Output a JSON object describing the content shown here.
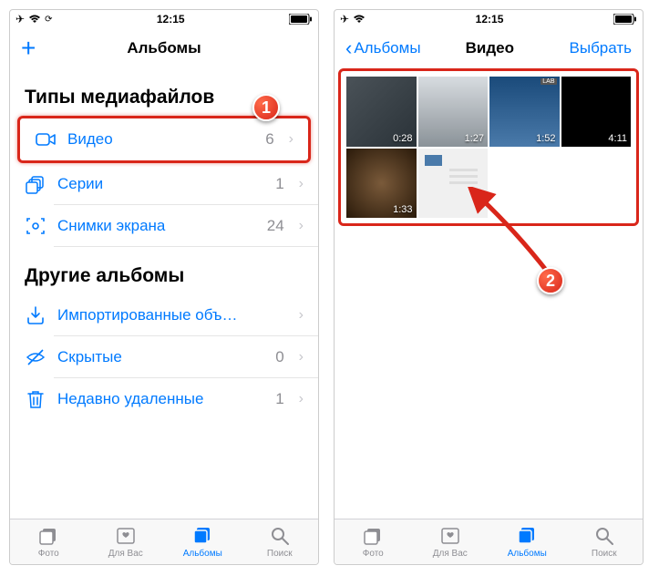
{
  "status": {
    "time": "12:15"
  },
  "screen1": {
    "nav": {
      "title": "Альбомы"
    },
    "sections": {
      "media_types_header": "Типы медиафайлов",
      "other_albums_header": "Другие альбомы"
    },
    "rows": {
      "video": {
        "label": "Видео",
        "count": "6"
      },
      "bursts": {
        "label": "Серии",
        "count": "1"
      },
      "screenshots": {
        "label": "Снимки экрана",
        "count": "24"
      },
      "imported": {
        "label": "Импортированные объ…",
        "count": ""
      },
      "hidden": {
        "label": "Скрытые",
        "count": "0"
      },
      "deleted": {
        "label": "Недавно удаленные",
        "count": "1"
      }
    }
  },
  "screen2": {
    "nav": {
      "back": "Альбомы",
      "title": "Видео",
      "select": "Выбрать"
    },
    "videos": {
      "d0": "0:28",
      "d1": "1:27",
      "d2": "1:52",
      "d3": "4:11",
      "d4": "1:33"
    }
  },
  "badges": {
    "b1": "1",
    "b2": "2"
  },
  "tabs": {
    "photos": "Фото",
    "for_you": "Для Вас",
    "albums": "Альбомы",
    "search": "Поиск"
  }
}
